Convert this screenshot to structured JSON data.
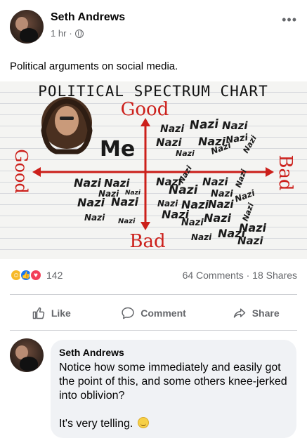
{
  "post": {
    "author": "Seth Andrews",
    "time": "1 hr",
    "separator": "·",
    "more_label": "•••",
    "text": "Political arguments on social media."
  },
  "meme": {
    "title": "POLITICAL SPECTRUM CHART",
    "top_label": "Good",
    "bottom_label": "Bad",
    "left_label": "Good",
    "right_label": "Bad",
    "me_label": "Me",
    "repeated_word": "Nazi"
  },
  "engagement": {
    "reaction_icons": [
      "haha-icon",
      "like-icon",
      "love-icon"
    ],
    "reaction_count": "142",
    "comments": "64 Comments",
    "dot": "·",
    "shares": "18 Shares"
  },
  "actions": {
    "like": "Like",
    "comment": "Comment",
    "share": "Share"
  },
  "comment": {
    "author": "Seth Andrews",
    "text": "Notice how some immediately and easily got the point of this, and some others knee-jerked into oblivion?\n\nIt's very telling."
  },
  "colors": {
    "meme_red": "#cc1f1a",
    "meme_ink": "#1a1a1a",
    "facebook_blue": "#1877f2",
    "secondary_text": "#65676b"
  }
}
